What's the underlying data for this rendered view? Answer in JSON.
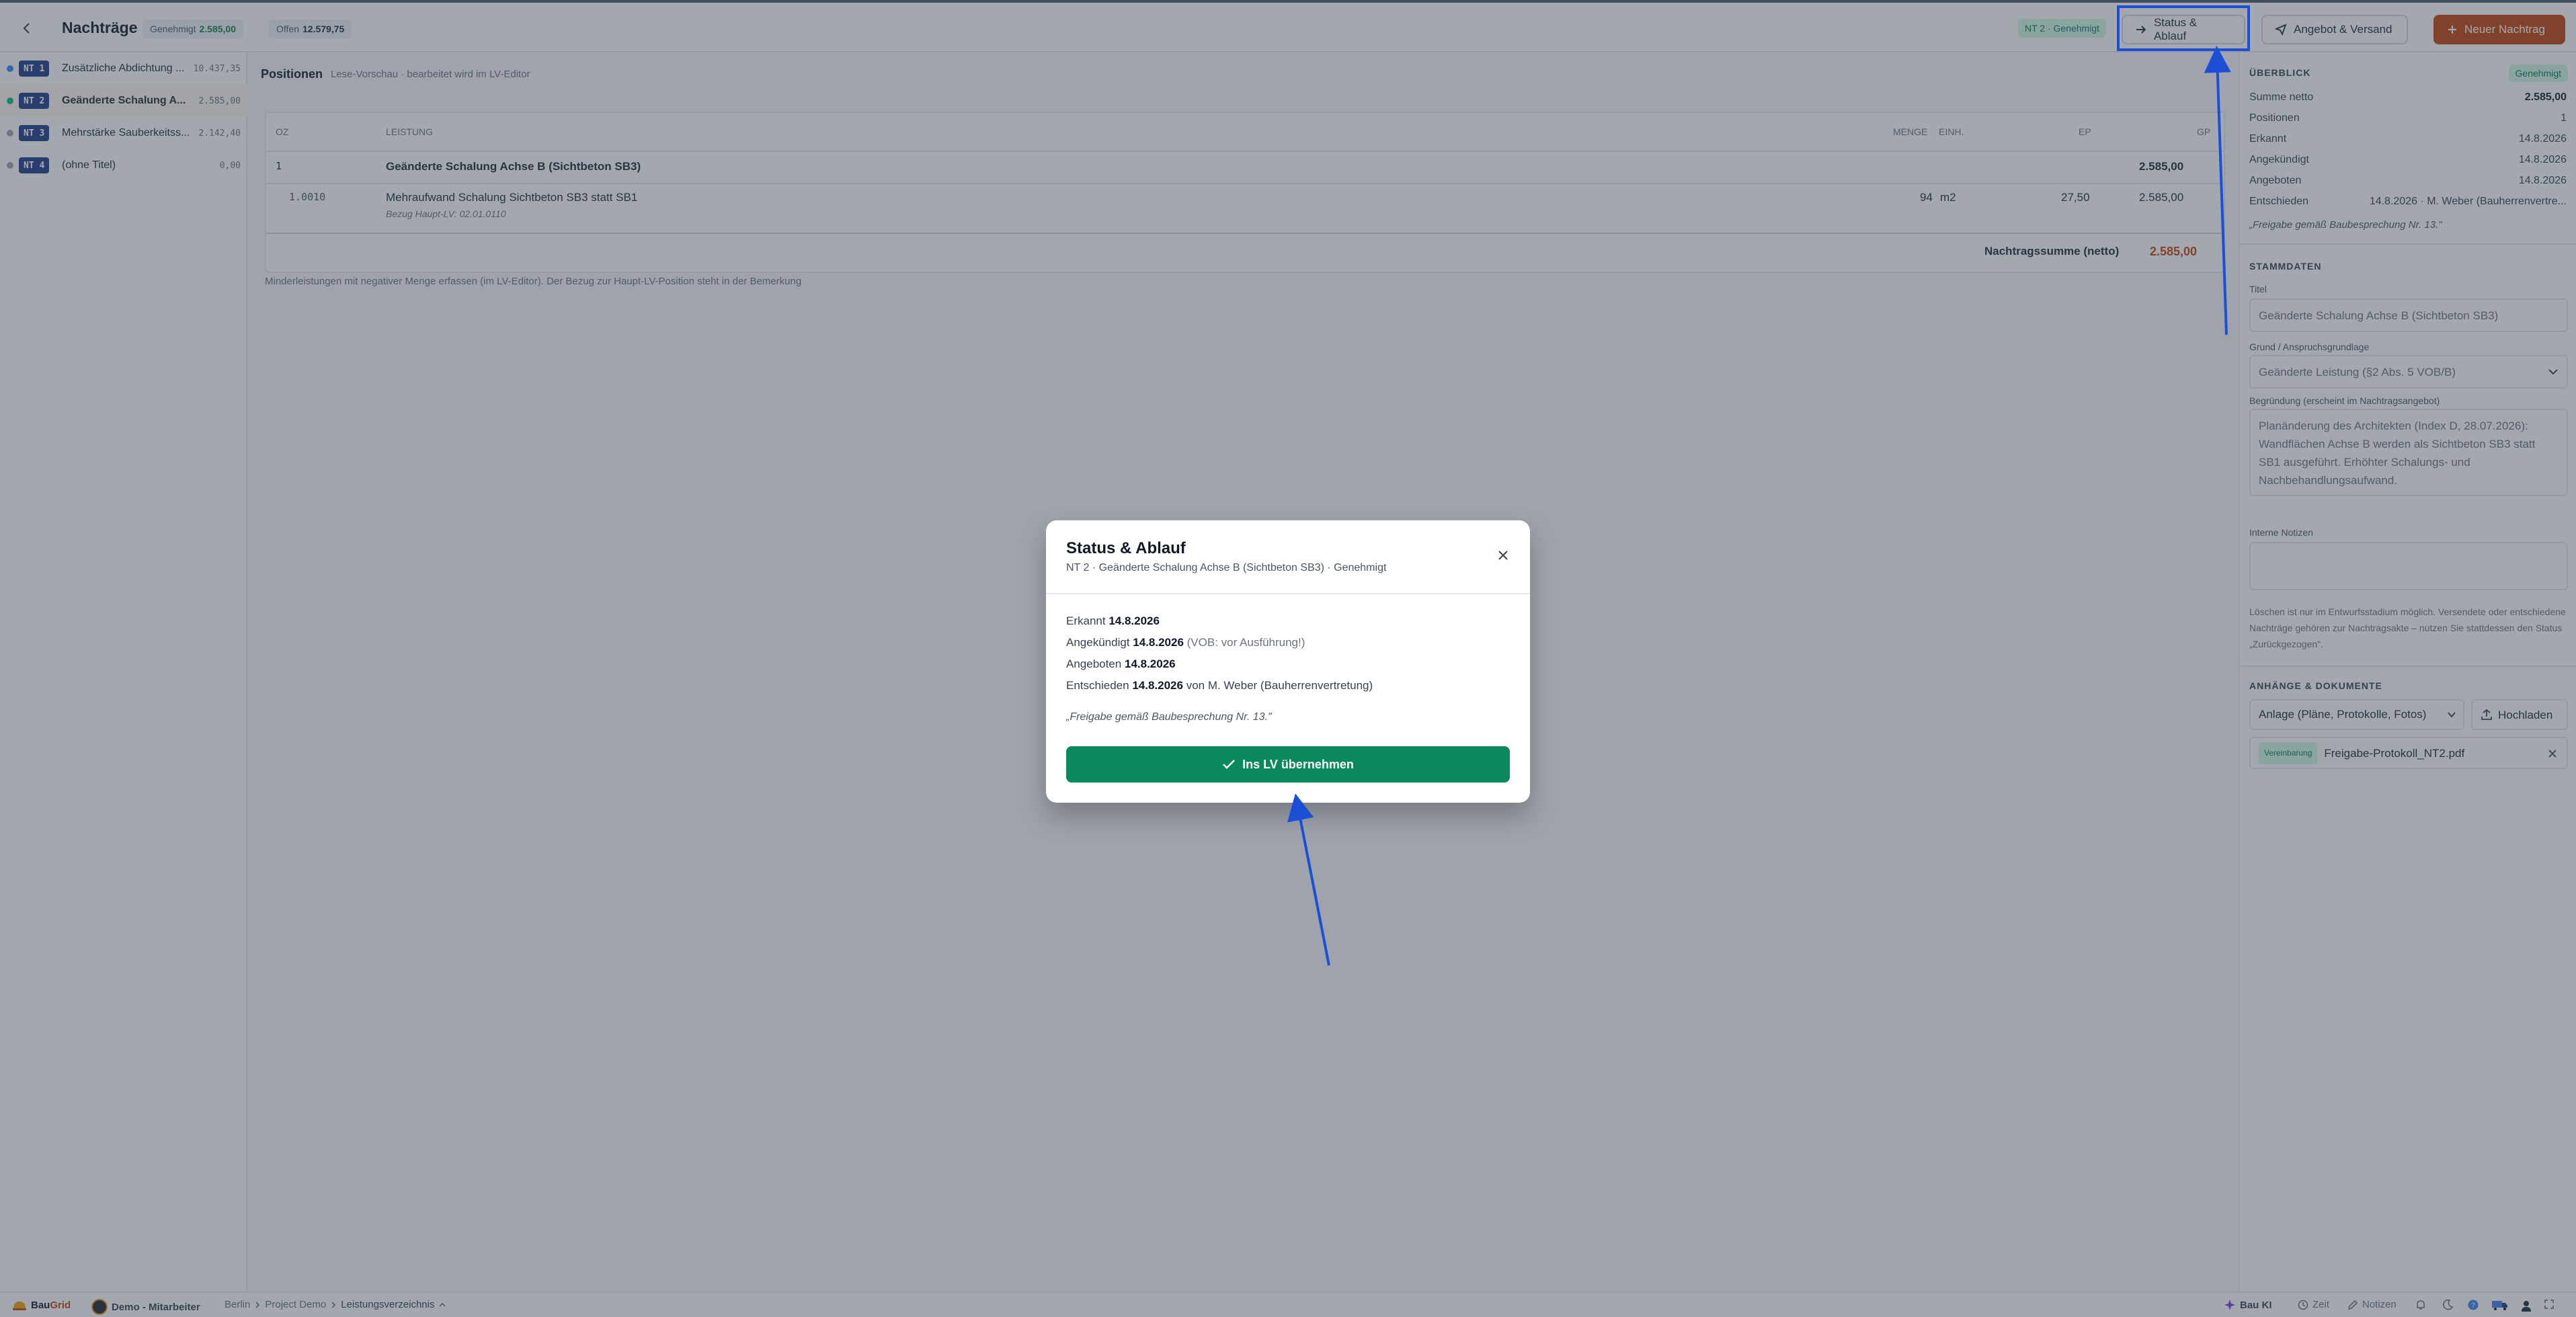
{
  "header": {
    "title": "Nachträge",
    "approved_label": "Genehmigt",
    "approved_value": "2.585,00",
    "open_label": "Offen",
    "open_value": "12.579,75",
    "nt_status": "NT 2 · Genehmigt",
    "btn_status": "Status & Ablauf",
    "btn_offer": "Angebot & Versand",
    "btn_new": "Neuer Nachtrag"
  },
  "sidebar": {
    "items": [
      {
        "tag": "NT 1",
        "title": "Zusätzliche Abdichtung ...",
        "amount": "10.437,35",
        "dot": "#3b82f6"
      },
      {
        "tag": "NT 2",
        "title": "Geänderte Schalung A...",
        "amount": "2.585,00",
        "dot": "#10b981"
      },
      {
        "tag": "NT 3",
        "title": "Mehrstärke Sauberkeitss...",
        "amount": "2.142,40",
        "dot": "#9ca3af"
      },
      {
        "tag": "NT 4",
        "title": "(ohne Titel)",
        "amount": "0,00",
        "dot": "#9ca3af"
      }
    ]
  },
  "positions": {
    "title": "Positionen",
    "subtitle": "Lese-Vorschau · bearbeitet wird im LV-Editor",
    "columns": {
      "oz": "OZ",
      "leistung": "LEISTUNG",
      "menge": "MENGE",
      "einh": "EINH.",
      "ep": "EP",
      "gp": "GP"
    },
    "group": {
      "oz": "1",
      "title": "Geänderte Schalung Achse B (Sichtbeton SB3)",
      "gp": "2.585,00"
    },
    "item": {
      "oz": "1.0010",
      "title": "Mehraufwand Schalung Sichtbeton SB3 statt SB1",
      "ref": "Bezug Haupt-LV: 02.01.0110",
      "menge": "94",
      "einh": "m2",
      "ep": "27,50",
      "gp": "2.585,00"
    },
    "sum_label": "Nachtragssumme (netto)",
    "sum_value": "2.585,00",
    "note": "Minderleistungen mit negativer Menge erfassen (im LV-Editor). Der Bezug zur Haupt-LV-Position steht in der Bemerkung"
  },
  "overview": {
    "title": "ÜBERBLICK",
    "status": "Genehmigt",
    "rows": [
      {
        "label": "Summe netto",
        "value": "2.585,00"
      },
      {
        "label": "Positionen",
        "value": "1"
      },
      {
        "label": "Erkannt",
        "value": "14.8.2026"
      },
      {
        "label": "Angekündigt",
        "value": "14.8.2026"
      },
      {
        "label": "Angeboten",
        "value": "14.8.2026"
      },
      {
        "label": "Entschieden",
        "value": "14.8.2026 · M. Weber (Bauherrenvertre..."
      }
    ],
    "quote": "„Freigabe gemäß Baubesprechung Nr. 13.\""
  },
  "stammdaten": {
    "title": "STAMMDATEN",
    "titel_label": "Titel",
    "titel_value": "Geänderte Schalung Achse B (Sichtbeton SB3)",
    "grund_label": "Grund / Anspruchsgrundlage",
    "grund_value": "Geänderte Leistung (§2 Abs. 5 VOB/B)",
    "begr_label": "Begründung (erscheint im Nachtragsangebot)",
    "begr_value": "Planänderung des Architekten (Index D, 28.07.2026): Wandflächen Achse B werden als Sichtbeton SB3 statt SB1 ausgeführt. Erhöhter Schalungs- und Nachbehandlungsaufwand.",
    "notes_label": "Interne Notizen",
    "hint": "Löschen ist nur im Entwurfsstadium möglich. Versendete oder entschiedene Nachträge gehören zur Nachtragsakte – nutzen Sie stattdessen den Status „Zurückgezogen\"."
  },
  "attachments": {
    "title": "ANHÄNGE & DOKUMENTE",
    "select": "Anlage (Pläne, Protokolle, Fotos)",
    "upload": "Hochladen",
    "file_tag": "Vereinbarung",
    "file_name": "Freigabe-Protokoll_NT2.pdf"
  },
  "footer": {
    "brand_a": "Bau",
    "brand_b": "Grid",
    "user": "Demo - Mitarbeiter",
    "crumbs": [
      "Berlin",
      "Project Demo",
      "Leistungsverzeichnis"
    ],
    "bau_ki": "Bau KI",
    "zeit": "Zeit",
    "notizen": "Notizen"
  },
  "modal": {
    "title": "Status & Ablauf",
    "subtitle": "NT 2 · Geänderte Schalung Achse B (Sichtbeton SB3) · Genehmigt",
    "erkannt_label": "Erkannt",
    "erkannt_value": "14.8.2026",
    "angekuendigt_label": "Angekündigt",
    "angekuendigt_value": "14.8.2026",
    "angekuendigt_note": "(VOB: vor Ausführung!)",
    "angeboten_label": "Angeboten",
    "angeboten_value": "14.8.2026",
    "entschieden_label": "Entschieden",
    "entschieden_value": "14.8.2026",
    "entschieden_by": "von M. Weber (Bauherrenvertretung)",
    "quote": "„Freigabe gemäß Baubesprechung Nr. 13.\"",
    "button": "Ins LV übernehmen"
  },
  "colors": {
    "accent": "#c2410c",
    "success": "#0a8a5c",
    "annotation": "#1d4ed8",
    "nt_tag": "#1e3a8a"
  }
}
